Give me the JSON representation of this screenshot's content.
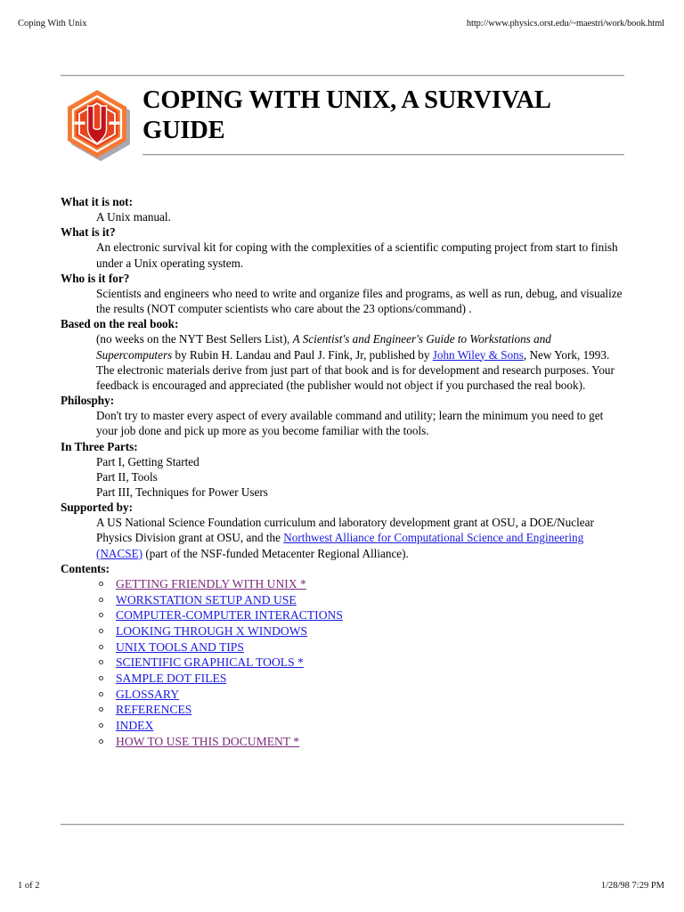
{
  "print_header": {
    "left": "Coping With Unix",
    "right": "http://www.physics.orst.edu/~maestri/work/book.html"
  },
  "document": {
    "title": "COPING WITH UNIX, A SURVIVAL GUIDE",
    "logo": {
      "name": "unix-hexagon-logo",
      "outer_hex_color": "#F47A33",
      "inner_hex_color": "#E8441E",
      "letter_color": "#C3121A",
      "shadow_color": "#8C8C9A"
    }
  },
  "sections": [
    {
      "term": "What it is not:",
      "lines": [
        "A Unix manual."
      ]
    },
    {
      "term": "What is it?",
      "lines": [
        "An electronic survival kit for coping with the complexities of a scientific computing project from start to finish under a Unix operating system."
      ]
    },
    {
      "term": "Who is it for?",
      "lines": [
        "Scientists and engineers who need to write and organize files and programs, as well as run, debug, and visualize the results (NOT computer scientists who care about the 23 options/command) ."
      ]
    },
    {
      "term": "Based on the real book:",
      "rich": {
        "part1": "(no weeks on the NYT Best Sellers List), ",
        "italic": "A Scientist's and Engineer's Guide to Workstations and Supercomputers",
        "part2": " by Rubin H. Landau and Paul J. Fink, Jr, published by ",
        "link": "John Wiley & Sons",
        "part3": ", New York, 1993. The electronic materials derive from just part of that book and is for development and research purposes. Your feedback is encouraged and appreciated (the publisher would not object if you purchased the real book)."
      }
    },
    {
      "term": "Philosphy:",
      "lines": [
        "Don't try to master every aspect of every available command and utility; learn the minimum you need to get your job done and pick up more as you become familiar with the tools."
      ]
    },
    {
      "term": "In Three Parts:",
      "lines": [
        "Part I, Getting Started",
        "Part II, Tools",
        "Part III, Techniques for Power Users"
      ]
    },
    {
      "term": "Supported by:",
      "rich2": {
        "part1": "A US National Science Foundation curriculum and laboratory development grant at OSU, a DOE/Nuclear Physics Division grant at OSU, and the ",
        "link": "Northwest Alliance for Computational Science and Engineering (NACSE)",
        "part2": " (part of the NSF-funded Metacenter Regional Alliance)."
      }
    }
  ],
  "contents": {
    "term": "Contents:",
    "items": [
      {
        "label": "GETTING FRIENDLY WITH UNIX *",
        "visited": true
      },
      {
        "label": "WORKSTATION SETUP AND USE",
        "visited": false
      },
      {
        "label": "COMPUTER-COMPUTER INTERACTIONS",
        "visited": false
      },
      {
        "label": "LOOKING THROUGH X WINDOWS",
        "visited": false
      },
      {
        "label": "UNIX TOOLS AND TIPS",
        "visited": false
      },
      {
        "label": "SCIENTIFIC GRAPHICAL TOOLS *",
        "visited": false
      },
      {
        "label": "SAMPLE DOT FILES",
        "visited": false
      },
      {
        "label": "GLOSSARY",
        "visited": false
      },
      {
        "label": "REFERENCES",
        "visited": false
      },
      {
        "label": "INDEX",
        "visited": false
      },
      {
        "label": "HOW TO USE THIS DOCUMENT *",
        "visited": true
      }
    ]
  },
  "print_footer": {
    "left": "1 of 2",
    "right": "1/28/98 7:29 PM"
  },
  "colors": {
    "link": "#1a1ae0",
    "link_visited": "#7b2a7b",
    "rule": "#9a9a9a"
  }
}
